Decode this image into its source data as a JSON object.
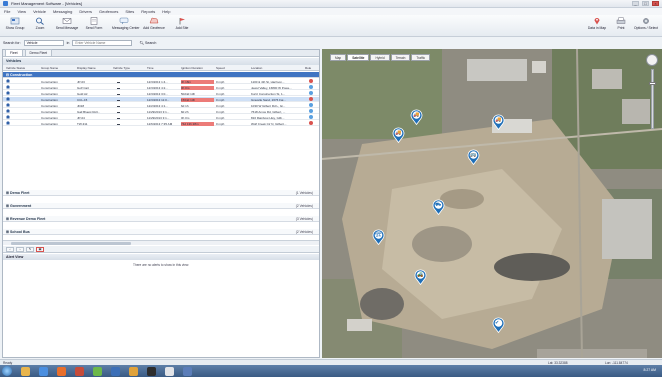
{
  "window": {
    "title": "Fleet Management Software - [Vehicles]"
  },
  "menu": [
    "File",
    "View",
    "Vehicle",
    "Messaging",
    "Drivers",
    "Geofences",
    "Sites",
    "Reports",
    "Help"
  ],
  "ribbon": {
    "left": [
      "Show Group",
      "Zoom",
      "Send Message",
      "Send Form",
      "Messaging Center",
      "Add Geofence",
      "Add Site"
    ],
    "right": [
      "Data in Map",
      "Print",
      "Options / Select"
    ]
  },
  "search": {
    "label": "Search for:",
    "type": "Vehicle",
    "in_label": "in",
    "placeholder": "Enter Vehicle Name",
    "button": "Search"
  },
  "tabs": [
    "Fleet",
    "Demo Fleet"
  ],
  "vehicles_header": "Vehicles",
  "columns": [
    "Vehicle Status",
    "Group Name",
    "Display Name",
    "Vehicle Type",
    "Time",
    "Ignition Duration",
    "Speed",
    "Location",
    "Role"
  ],
  "groups": [
    {
      "name": "Construction",
      "count": "",
      "selected": true
    },
    {
      "name": "Demo Fleet",
      "count": "(1 Vehicles)"
    },
    {
      "name": "Government",
      "count": "(2 Vehicles)"
    },
    {
      "name": "Revenue Demo Fleet",
      "count": "(3 Vehicles)"
    },
    {
      "name": "School Bus",
      "count": "(2 Vehicles)"
    }
  ],
  "rows": [
    {
      "group": "Construction",
      "name": "JP-03",
      "type": "▬",
      "time": "12/3/2013 1:4...",
      "dur": "3h 18m",
      "speed": "0 mph",
      "loc": "1100 & 4th St, Harrison...",
      "flag": true,
      "hl": false,
      "end": "#d9534f"
    },
    {
      "group": "Construction",
      "name": "Golf Cart",
      "type": "▬",
      "time": "12/3/2013 4:2...",
      "dur": "0h 0m",
      "speed": "0 mph",
      "loc": "Jewel Valley, 16800 W Powe...",
      "flag": true,
      "hl": false,
      "end": "#5aa0e0"
    },
    {
      "group": "Construction",
      "name": "Gold Air",
      "type": "▬",
      "time": "12/3/2013 3:0...",
      "dur": "5024d 13h",
      "speed": "0 mph",
      "loc": "Kurtz Construction St, 1...",
      "flag": false,
      "hl": false,
      "end": "#5aa0e0"
    },
    {
      "group": "Construction",
      "name": "CCL-15",
      "type": "▬",
      "time": "12/3/2013 11:0...",
      "dur": "1564d 13h",
      "speed": "0 mph",
      "loc": "Gravelle Sand, 2676 Fai...",
      "flag": true,
      "hl": true,
      "end": "#d9534f"
    },
    {
      "group": "Construction",
      "name": "JD18",
      "type": "▬",
      "time": "12/2/2013 4:1...",
      "dur": "6d 1h",
      "speed": "0 mph",
      "loc": "1030 W Gilbert Rd L, Gi...",
      "flag": false,
      "hl": false,
      "end": "#5aa0e0"
    },
    {
      "group": "Construction",
      "name": "Gail Bluest Roll...",
      "type": "▬",
      "time": "11/29/2013 3:1...",
      "dur": "8d 2h",
      "speed": "0 mph",
      "loc": "7618 Amos Rd, Gilbert, ...",
      "flag": false,
      "hl": false,
      "end": "#5aa0e0"
    },
    {
      "group": "Construction",
      "name": "JP-04",
      "type": "▬",
      "time": "11/29/2013 3:1...",
      "dur": "0h 0m",
      "speed": "0 mph",
      "loc": "810 Rainbow Hwy, Gilb...",
      "flag": false,
      "hl": false,
      "end": "#5aa0e0"
    },
    {
      "group": "Construction",
      "name": "TW-311",
      "type": "▬",
      "time": "12/6/2013 7:35 AM",
      "dur": "74d 13h 28m",
      "speed": "0 mph",
      "loc": "Wolf Creek Cir N, Gilbert...",
      "flag": true,
      "hl": false,
      "end": "#d9534f"
    }
  ],
  "bottom_toolbar": [
    "‹",
    "›",
    "✎",
    "▣"
  ],
  "alert": {
    "header": "Alert View",
    "message": "There are no alerts to show in this view."
  },
  "map": {
    "tabs": [
      "Map",
      "Satellite",
      "Hybrid",
      "Terrain",
      "Traffic"
    ],
    "active_tab": "Satellite",
    "markers": [
      "truck",
      "truck",
      "truck",
      "bus",
      "roller",
      "crane",
      "dumptruck",
      "check"
    ]
  },
  "status": {
    "left": "Ready",
    "lat": "Lat: 33.32388",
    "lon": "Lon: -111.84774"
  },
  "taskbar": {
    "clock": "8:27 AM"
  },
  "colors": {
    "accent": "#3f74c2",
    "alert_red": "#ec7b78",
    "selected_row": "#cfe0f6"
  }
}
